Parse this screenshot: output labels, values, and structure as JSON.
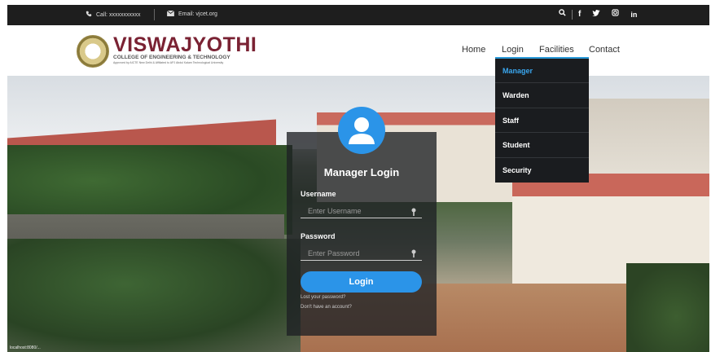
{
  "topbar": {
    "call": "Call: xxxxxxxxxxx",
    "email": "Email: vjcet.org",
    "icons": [
      "search-icon",
      "facebook-icon",
      "twitter-icon",
      "instagram-icon",
      "linkedin-icon"
    ],
    "social_glyphs": {
      "facebook": "f",
      "twitter": "♥",
      "instagram": "◎",
      "linkedin": "in"
    }
  },
  "brand": {
    "title": "VISWAJYOTHI",
    "subtitle": "COLLEGE OF ENGINEERING & TECHNOLOGY",
    "tagline": "Approved by AICTE New Delhi & Affiliated to APJ Abdul Kalam Technological University"
  },
  "nav": {
    "items": [
      "Home",
      "Login",
      "Facilities",
      "Contact"
    ],
    "login_menu": [
      "Manager",
      "Warden",
      "Staff",
      "Student",
      "Security"
    ],
    "active_menu_item": "Manager"
  },
  "login": {
    "title": "Manager Login",
    "username_label": "Username",
    "username_placeholder": "Enter Username",
    "password_label": "Password",
    "password_placeholder": "Enter Password",
    "button": "Login",
    "lost_password": "Lost your password?",
    "no_account": "Don't have an account?"
  },
  "footer_corner": "localhost:8080/...",
  "colors": {
    "accent": "#2b94e8",
    "topbar": "#1e1e1e",
    "brand": "#7a2233",
    "dropdown": "#1a1c1f"
  }
}
